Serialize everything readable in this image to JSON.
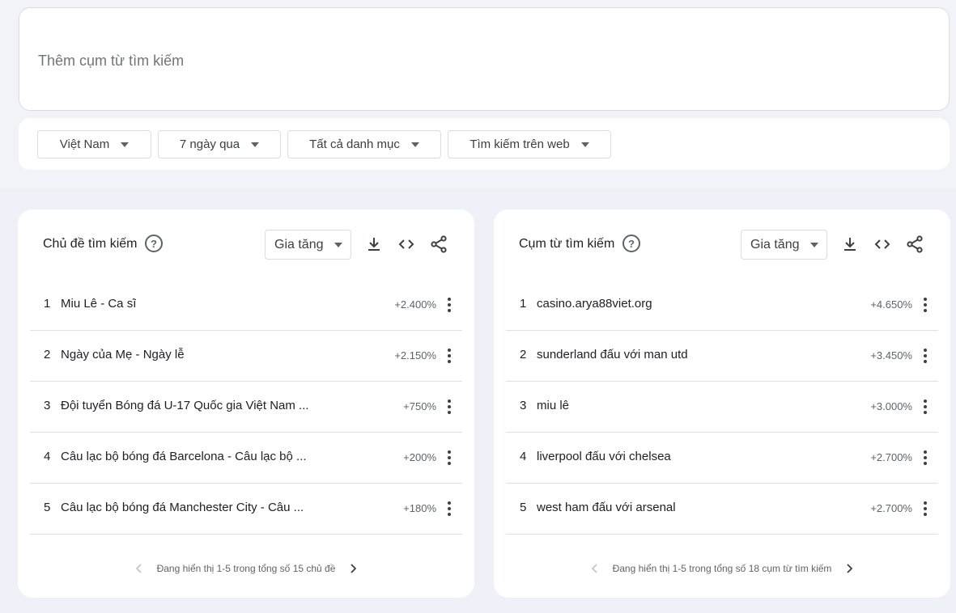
{
  "search": {
    "placeholder": "Thêm cụm từ tìm kiếm"
  },
  "filters": [
    {
      "label": "Việt Nam"
    },
    {
      "label": "7 ngày qua"
    },
    {
      "label": "Tất cả danh mục"
    },
    {
      "label": "Tìm kiếm trên web"
    }
  ],
  "panels": [
    {
      "title": "Chủ đề tìm kiếm",
      "help_icon": "?",
      "sort_label": "Gia tăng",
      "icons": [
        "download-icon",
        "embed-code-icon",
        "share-icon"
      ],
      "rows": [
        {
          "rank": "1",
          "name": "Miu Lê - Ca sĩ",
          "value": "+2.400%"
        },
        {
          "rank": "2",
          "name": "Ngày của Mẹ - Ngày lễ",
          "value": "+2.150%"
        },
        {
          "rank": "3",
          "name": "Đội tuyển Bóng đá U-17 Quốc gia Việt Nam ...",
          "value": "+750%"
        },
        {
          "rank": "4",
          "name": "Câu lạc bộ bóng đá Barcelona - Câu lạc bộ ...",
          "value": "+200%"
        },
        {
          "rank": "5",
          "name": "Câu lạc bộ bóng đá Manchester City - Câu ...",
          "value": "+180%"
        }
      ],
      "pager_text": "Đang hiển thị 1-5 trong tổng số 15 chủ đề"
    },
    {
      "title": "Cụm từ tìm kiếm",
      "help_icon": "?",
      "sort_label": "Gia tăng",
      "icons": [
        "download-icon",
        "embed-code-icon",
        "share-icon"
      ],
      "rows": [
        {
          "rank": "1",
          "name": "casino.arya88viet.org",
          "value": "+4.650%"
        },
        {
          "rank": "2",
          "name": "sunderland đấu với man utd",
          "value": "+3.450%"
        },
        {
          "rank": "3",
          "name": "miu lê",
          "value": "+3.000%"
        },
        {
          "rank": "4",
          "name": "liverpool đấu với chelsea",
          "value": "+2.700%"
        },
        {
          "rank": "5",
          "name": "west ham đấu với arsenal",
          "value": "+2.700%"
        }
      ],
      "pager_text": "Đang hiển thị 1-5 trong tổng số 18 cụm từ tìm kiếm"
    }
  ]
}
